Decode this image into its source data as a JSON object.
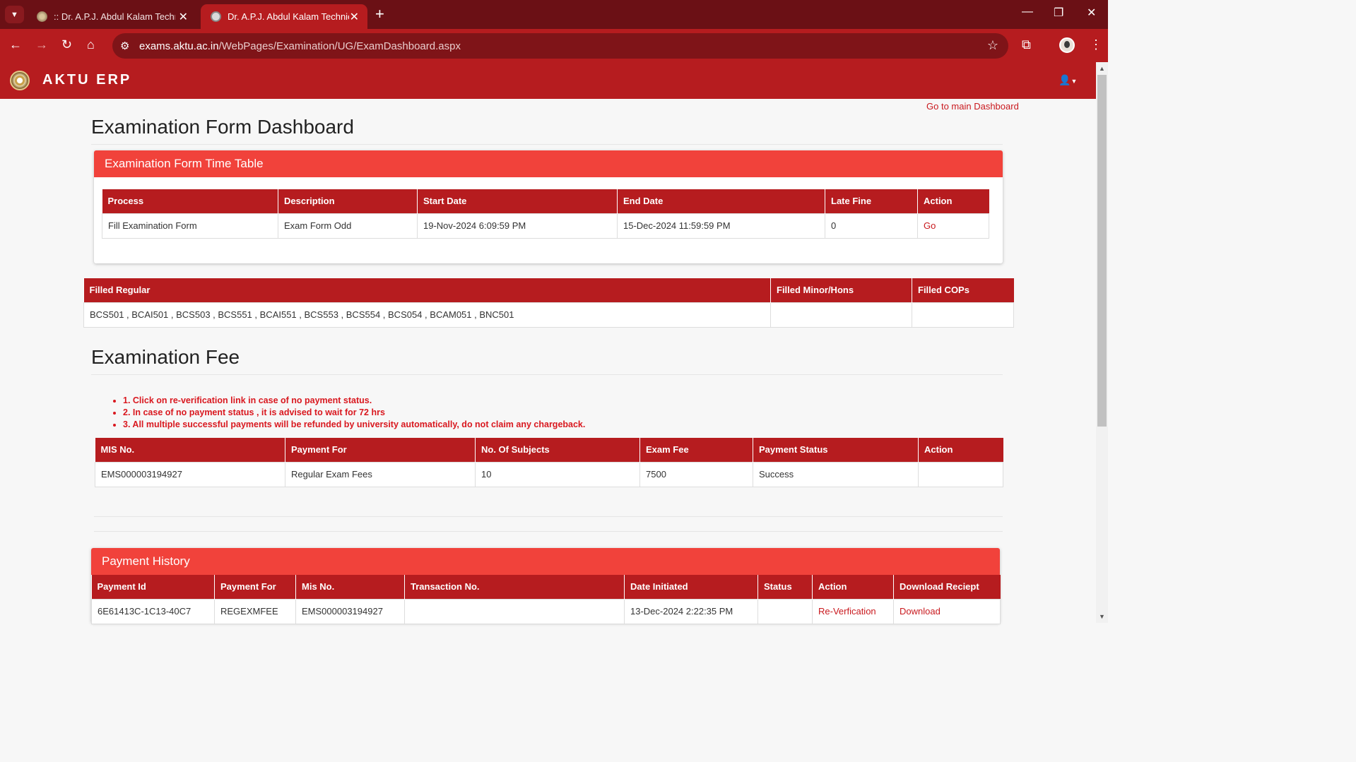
{
  "browser": {
    "tabs": [
      {
        "title": ":: Dr. A.P.J. Abdul Kalam Technical University ::",
        "active": false
      },
      {
        "title": "Dr. A.P.J. Abdul Kalam Technical University",
        "active": true
      }
    ],
    "url_host": "exams.aktu.ac.in",
    "url_path": "/WebPages/Examination/UG/ExamDashboard.aspx"
  },
  "app": {
    "brand": "AKTU ERP",
    "main_dashboard_link": "Go to main Dashboard"
  },
  "page_title": "Examination Form Dashboard",
  "timetable": {
    "title": "Examination Form Time Table",
    "columns": [
      "Process",
      "Description",
      "Start Date",
      "End Date",
      "Late Fine",
      "Action"
    ],
    "rows": [
      {
        "process": "Fill Examination Form",
        "description": "Exam Form Odd",
        "start": "19-Nov-2024 6:09:59 PM",
        "end": "15-Dec-2024 11:59:59 PM",
        "late_fine": "0",
        "action": "Go"
      }
    ]
  },
  "filled": {
    "columns": [
      "Filled Regular",
      "Filled Minor/Hons",
      "Filled COPs"
    ],
    "regular": "BCS501 , BCAI501 , BCS503 , BCS551 , BCAI551 , BCS553 , BCS554 , BCS054 , BCAM051 , BNC501",
    "minor_hons": "",
    "cops": ""
  },
  "fee": {
    "title": "Examination Fee",
    "notes": [
      "1. Click on re-verification link in case of no payment status.",
      "2. In case of no payment status , it is advised to wait for 72 hrs",
      "3. All multiple successful payments will be refunded by university automatically, do not claim any chargeback."
    ],
    "columns": [
      "MIS No.",
      "Payment For",
      "No. Of Subjects",
      "Exam Fee",
      "Payment Status",
      "Action"
    ],
    "rows": [
      {
        "mis": "EMS000003194927",
        "payment_for": "Regular Exam Fees",
        "subjects": "10",
        "fee": "7500",
        "status": "Success",
        "action": ""
      }
    ]
  },
  "history": {
    "title": "Payment History",
    "columns": [
      "Payment Id",
      "Payment For",
      "Mis No.",
      "Transaction No.",
      "Date Initiated",
      "Status",
      "Action",
      "Download Reciept"
    ],
    "rows": [
      {
        "payment_id": "6E61413C-1C13-40C7",
        "payment_for": "REGEXMFEE",
        "mis": "EMS000003194927",
        "txn": "",
        "date": "13-Dec-2024 2:22:35 PM",
        "status": "",
        "action": "Re-Verfication",
        "download": "Download"
      }
    ]
  },
  "colors": {
    "brand_red": "#b61c1f",
    "panel_red": "#f1423b",
    "link_red": "#c9191e"
  }
}
